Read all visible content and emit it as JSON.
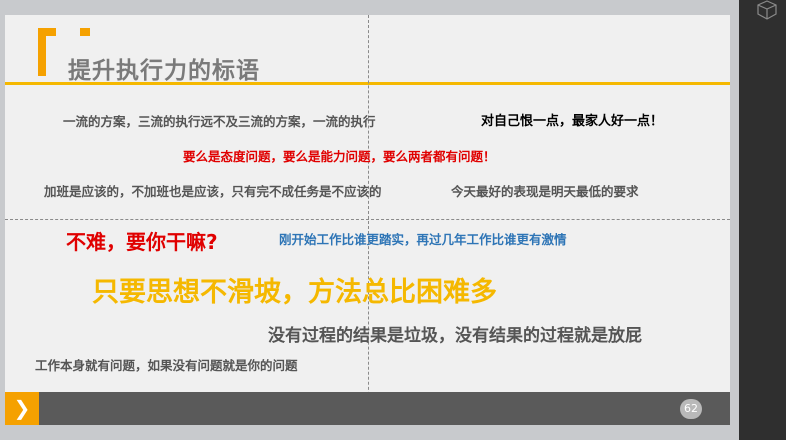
{
  "slide": {
    "title": "提升执行力的标语",
    "page_number": "62",
    "footer_arrow": "❯",
    "lines": {
      "l1": "一流的方案，三流的执行远不及三流的方案，一流的执行",
      "l2": "对自己恨一点，最家人好一点！",
      "l3": "要么是态度问题，要么是能力问题，要么两者都有问题！",
      "l4": "加班是应该的，不加班也是应该，只有完不成任务是不应该的",
      "l5": "今天最好的表现是明天最低的要求",
      "l6": "不难，要你干嘛?",
      "l7": "刚开始工作比谁更踏实，再过几年工作比谁更有激情",
      "l8": "只要思想不滑坡，方法总比困难多",
      "l9": "没有过程的结果是垃圾，没有结果的过程就是放屁",
      "l10": "工作本身就有问题，如果没有问题就是你的问题"
    }
  },
  "colors": {
    "accent_orange": "#f5a100",
    "accent_yellow": "#f5b800",
    "red": "#e00000",
    "blue": "#2e75b6",
    "gray_text": "#555555",
    "footer_bg": "#5a5a5a"
  },
  "icons": {
    "sidebar": "cube-icon",
    "footer": "chevron-right-icon"
  }
}
